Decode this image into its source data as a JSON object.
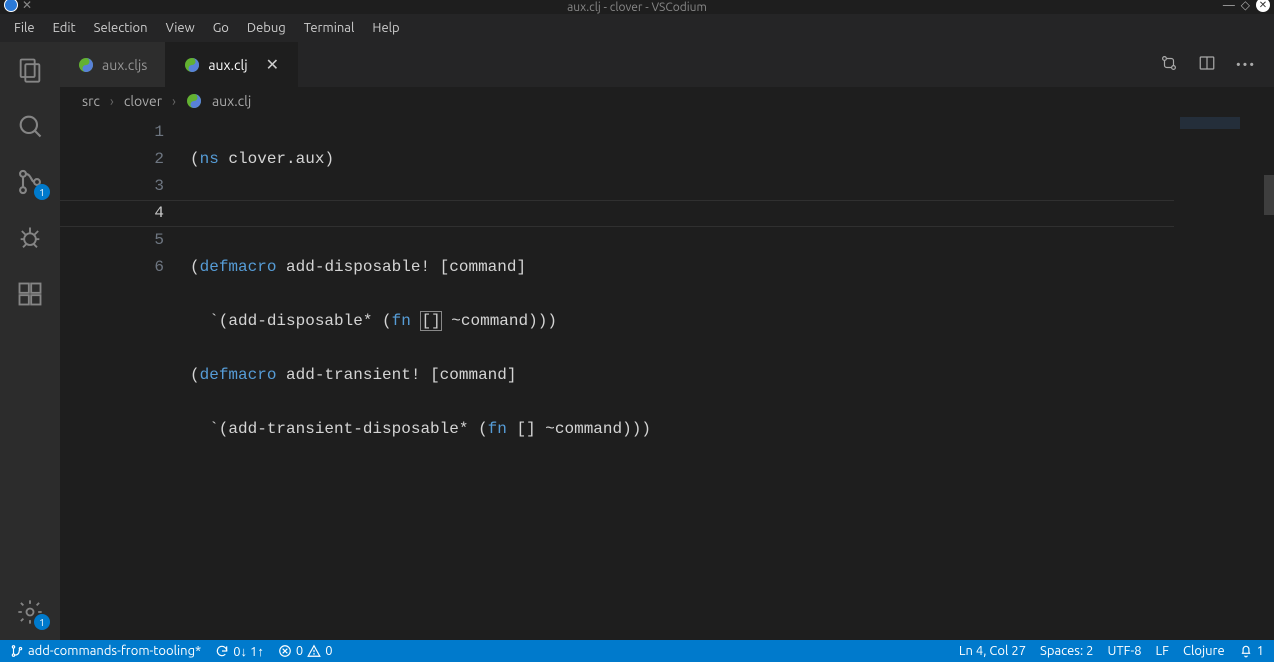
{
  "window": {
    "title": "aux.clj - clover - VSCodium"
  },
  "menu": [
    "File",
    "Edit",
    "Selection",
    "View",
    "Go",
    "Debug",
    "Terminal",
    "Help"
  ],
  "activity": {
    "scm_badge": "1",
    "settings_badge": "1"
  },
  "tabs": [
    {
      "label": "aux.cljs",
      "active": false
    },
    {
      "label": "aux.clj",
      "active": true
    }
  ],
  "breadcrumb": {
    "seg1": "src",
    "seg2": "clover",
    "seg3": "aux.clj"
  },
  "editor": {
    "line_numbers": [
      "1",
      "2",
      "3",
      "4",
      "5",
      "6"
    ],
    "highlighted_line_index": 3,
    "lines": {
      "l1": {
        "open": "(",
        "kw": "ns",
        "sp": " ",
        "name": "clover.aux",
        "close": ")"
      },
      "l2": "",
      "l3": {
        "open": "(",
        "kw": "defmacro",
        "sp": " ",
        "name": "add-disposable!",
        "sp2": " ",
        "args": "[command]"
      },
      "l4": {
        "indent": "  ",
        "tick": "`(",
        "call": "add-disposable*",
        "sp": " ",
        "open": "(",
        "fn": "fn",
        "sp2": " ",
        "lb": "[",
        "rb": "]",
        "sp3": " ",
        "unq": "~command",
        "close": ")))"
      },
      "l5": {
        "open": "(",
        "kw": "defmacro",
        "sp": " ",
        "name": "add-transient!",
        "sp2": " ",
        "args": "[command]"
      },
      "l6": {
        "indent": "  ",
        "tick": "`(",
        "call": "add-transient-disposable*",
        "sp": " ",
        "open": "(",
        "fn": "fn",
        "sp2": " ",
        "vec": "[]",
        "sp3": " ",
        "unq": "~command",
        "close": ")))"
      }
    }
  },
  "status": {
    "branch": "add-commands-from-tooling*",
    "sync": "0↓ 1↑",
    "errors": "0",
    "warnings": "0",
    "cursor": "Ln 4, Col 27",
    "indent": "Spaces: 2",
    "encoding": "UTF-8",
    "eol": "LF",
    "lang": "Clojure",
    "bell": "1"
  }
}
